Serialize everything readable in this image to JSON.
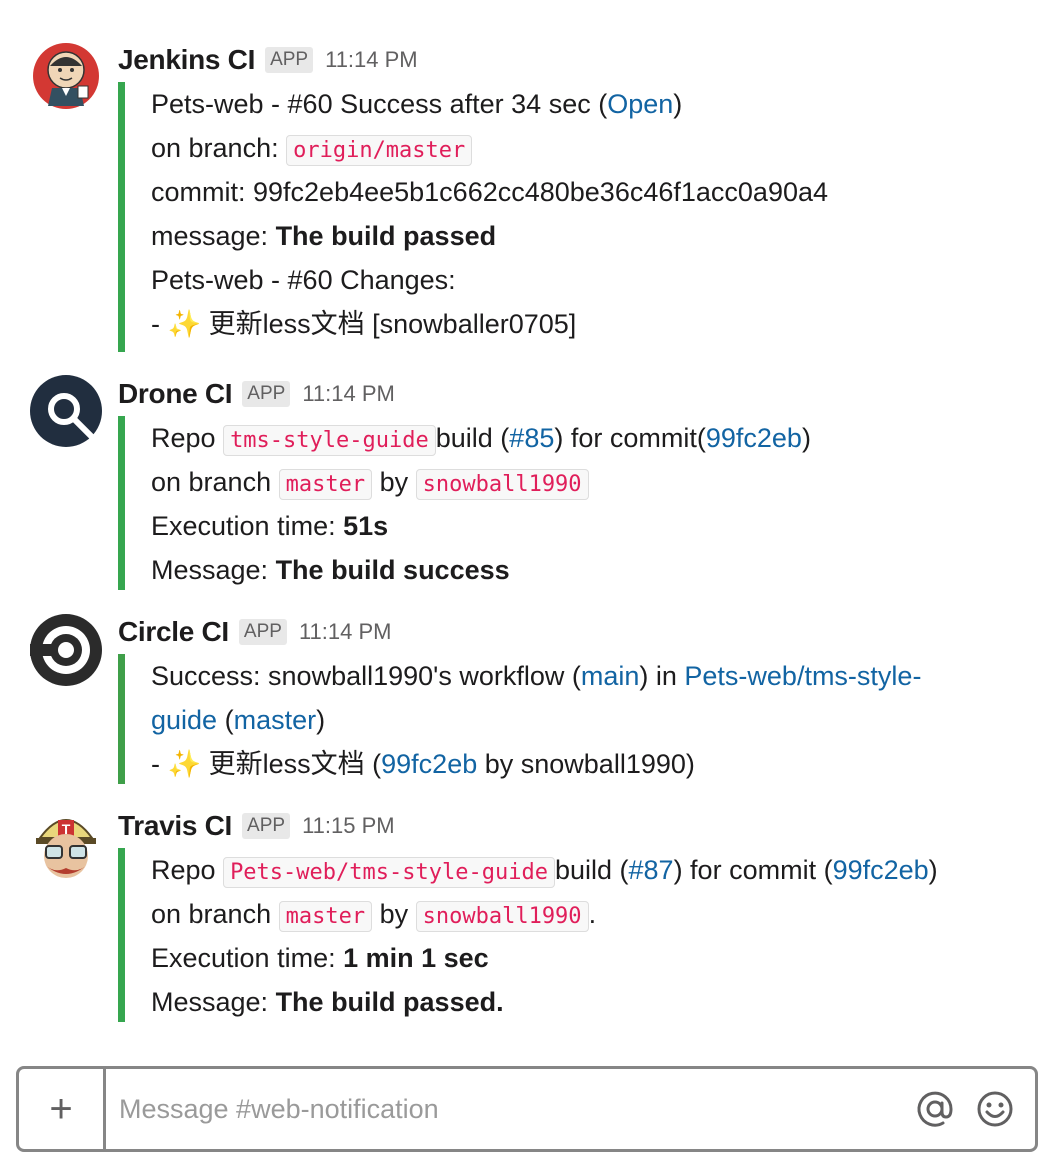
{
  "colors": {
    "attachment_border": "#36a64f",
    "link": "#1264a3",
    "code_text": "#e01e5a"
  },
  "messages": [
    {
      "sender": "Jenkins CI",
      "badge": "APP",
      "time": "11:14 PM",
      "avatar_icon": "jenkins-icon",
      "lines": [
        {
          "t1": "Pets-web - #60 Success after 34 sec (",
          "link": "Open",
          "t2": ")"
        },
        {
          "label": "on branch: ",
          "code": "origin/master"
        },
        {
          "text": "commit: 99fc2eb4ee5b1c662cc480be36c46f1acc0a90a4"
        },
        {
          "label": "message: ",
          "bold": "The build passed"
        },
        {
          "text": "Pets-web - #60 Changes:"
        },
        {
          "prefix": "- ",
          "emoji": "✨",
          "text": " 更新less文档 [snowballer0705]"
        }
      ]
    },
    {
      "sender": "Drone CI",
      "badge": "APP",
      "time": "11:14 PM",
      "avatar_icon": "drone-icon",
      "lines": [
        {
          "t1": "Repo ",
          "code": "tms-style-guide",
          "t2": "build (",
          "link1": "#85",
          "t3": ") for commit(",
          "link2": "99fc2eb",
          "t4": ")"
        },
        {
          "t1": "on branch ",
          "code1": "master",
          "t2": " by ",
          "code2": "snowball1990"
        },
        {
          "label": "Execution time: ",
          "bold": "51s"
        },
        {
          "label": "Message: ",
          "bold": "The build success"
        }
      ]
    },
    {
      "sender": "Circle CI",
      "badge": "APP",
      "time": "11:14 PM",
      "avatar_icon": "circleci-icon",
      "lines": [
        {
          "t1": "Success: snowball1990's workflow (",
          "link1": "main",
          "t2": ") in ",
          "link2": "Pets-web/tms-style-"
        },
        {
          "link1": "guide",
          "t1": " (",
          "link2": "master",
          "t2": ")"
        },
        {
          "prefix": "- ",
          "emoji": "✨",
          "t1": " 更新less文档 (",
          "link": "99fc2eb",
          "t2": " by snowball1990)"
        }
      ]
    },
    {
      "sender": "Travis CI",
      "badge": "APP",
      "time": "11:15 PM",
      "avatar_icon": "travis-icon",
      "lines": [
        {
          "t1": "Repo ",
          "code": "Pets-web/tms-style-guide",
          "t2": "build (",
          "link1": "#87",
          "t3": ") for commit (",
          "link2": "99fc2eb",
          "t4": ")"
        },
        {
          "t1": "on branch ",
          "code1": "master",
          "t2": " by ",
          "code2": "snowball1990",
          "t3": "."
        },
        {
          "label": "Execution time: ",
          "bold": "1 min 1 sec"
        },
        {
          "label": "Message: ",
          "bold": "The build passed."
        }
      ]
    }
  ],
  "composer": {
    "add_label": "+",
    "placeholder": "Message #web-notification",
    "mention_icon": "at-icon",
    "emoji_icon": "smiley-icon"
  }
}
